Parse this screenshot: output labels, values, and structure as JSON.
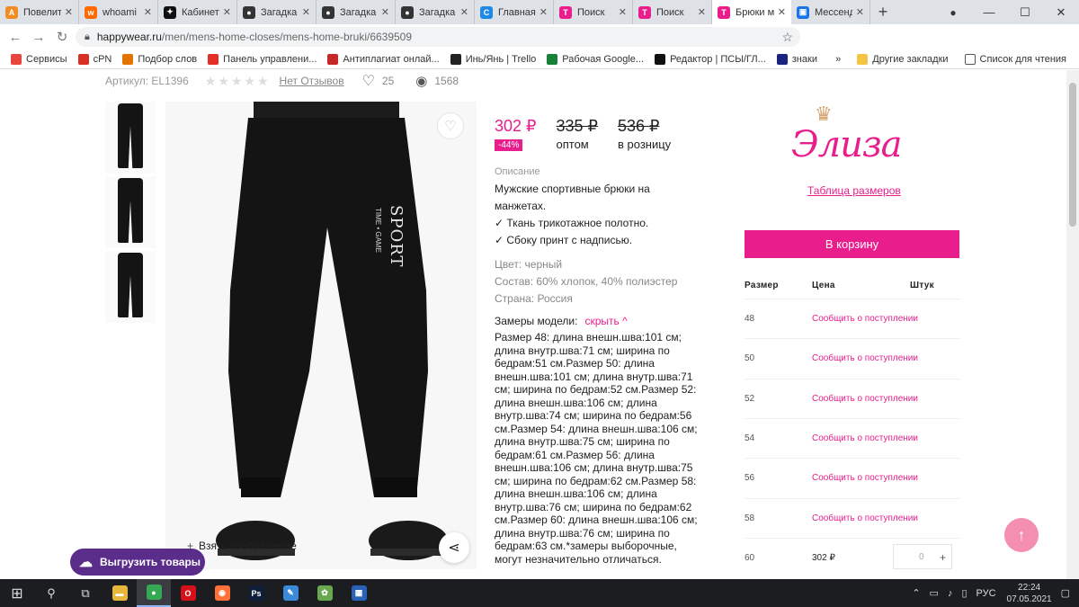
{
  "browser": {
    "tabs": [
      {
        "title": "Повелите",
        "color": "#f28b22",
        "glyph": "A"
      },
      {
        "title": "whoami",
        "color": "#ff6a00",
        "glyph": "w"
      },
      {
        "title": "Кабинет",
        "color": "#111111",
        "glyph": "✦"
      },
      {
        "title": "Загадка с",
        "color": "#333333",
        "glyph": "●"
      },
      {
        "title": "Загадка п",
        "color": "#333333",
        "glyph": "●"
      },
      {
        "title": "Загадка п",
        "color": "#333333",
        "glyph": "●"
      },
      {
        "title": "Главная",
        "color": "#1e88e5",
        "glyph": "C"
      },
      {
        "title": "Поиск",
        "color": "#e91e8c",
        "glyph": "T"
      },
      {
        "title": "Поиск",
        "color": "#e91e8c",
        "glyph": "T"
      },
      {
        "title": "Брюки м",
        "color": "#e91e8c",
        "glyph": "T"
      },
      {
        "title": "Мессенд",
        "color": "#1a73e8",
        "glyph": "▣"
      }
    ],
    "active_tab_index": 9,
    "url_host": "happywear.ru",
    "url_path": "/men/mens-home-closes/mens-home-bruki/6639509",
    "bookmarks": [
      {
        "label": "Сервисы",
        "color": "#e8453c"
      },
      {
        "label": "cPN",
        "color": "#d93025"
      },
      {
        "label": "Подбор слов",
        "color": "#e37400"
      },
      {
        "label": "Панель управлени...",
        "color": "#e52d27"
      },
      {
        "label": "Антиплагиат онлай...",
        "color": "#c62828"
      },
      {
        "label": "Инь/Янь | Trello",
        "color": "#222222"
      },
      {
        "label": "Рабочая Google...",
        "color": "#188038"
      },
      {
        "label": "Редактор | ПСЫ/ГЛ...",
        "color": "#111111"
      },
      {
        "label": "знаки",
        "color": "#1a237e"
      }
    ],
    "bookmarks_right": [
      "Другие закладки",
      "Список для чтения"
    ]
  },
  "product": {
    "article": "Артикул: EL1396",
    "reviews_link": "Нет Отзывов",
    "likes": "25",
    "views": "1568",
    "price_now": "302 ₽",
    "discount_badge": "-44%",
    "price_wholesale": "335 ₽",
    "price_wholesale_label": "оптом",
    "price_retail": "536 ₽",
    "price_retail_label": "в розницу",
    "description_label": "Описание",
    "description_lines": [
      "Мужские спортивные брюки на манжетах.",
      "✓ Ткань трикотажное полотно.",
      "✓ Сбоку принт с надписью."
    ],
    "color_line": "Цвет: черный",
    "composition_line": "Состав: 60% хлопок, 40% полиэстер",
    "country_line": "Страна: Россия",
    "sizes_label": "Замеры модели:",
    "sizes_toggle": "скрыть ^",
    "sizes_text": "Размер 48: длина внешн.шва:101 см; длина внутр.шва:71 см; ширина по бедрам:51 см.Размер 50: длина внешн.шва:101 см; длина внутр.шва:71 см; ширина по бедрам:52 см.Размер 52: длина внешн.шва:106 см; длина внутр.шва:74 см; ширина по бедрам:56 см.Размер 54: длина внешн.шва:106 см; длина внутр.шва:75 см; ширина по бедрам:61 см.Размер 56: длина внешн.шва:106 см; длина внутр.шва:75 см; ширина по бедрам:62 см.Размер 58: длина внешн.шва:106 см; длина внутр.шва:76 см; ширина по бедрам:62 см.Размер 60: длина внешн.шва:106 см; длина внутр.шва:76 см; ширина по бедрам:63 см.*замеры выборочные, могут незначительно отличаться.",
    "take_image": "Взять изображение",
    "upload_button": "Выгрузить товары",
    "print_text": "SPORT",
    "print_sub": "TIME • GAME"
  },
  "sidebar": {
    "logo_text": "Элиза",
    "size_table_link": "Таблица размеров",
    "cart_button": "В корзину",
    "table_headers": {
      "size": "Размер",
      "price": "Цена",
      "qty": "Штук"
    },
    "rows": [
      {
        "size": "48",
        "note": "Сообщить о поступлении"
      },
      {
        "size": "50",
        "note": "Сообщить о поступлении"
      },
      {
        "size": "52",
        "note": "Сообщить о поступлении"
      },
      {
        "size": "54",
        "note": "Сообщить о поступлении"
      },
      {
        "size": "56",
        "note": "Сообщить о поступлении"
      },
      {
        "size": "58",
        "note": "Сообщить о поступлении"
      }
    ],
    "last_row": {
      "size": "60",
      "price": "302 ₽",
      "qty": "0",
      "plus": "+"
    }
  },
  "taskbar": {
    "apps": [
      {
        "name": "search-icon",
        "glyph": "⚲",
        "color": ""
      },
      {
        "name": "task-view-icon",
        "glyph": "⧉",
        "color": ""
      },
      {
        "name": "file-explorer-icon",
        "glyph": "▬",
        "color": "#e8b63a"
      },
      {
        "name": "chrome-icon",
        "glyph": "●",
        "color": "#34a853"
      },
      {
        "name": "opera-icon",
        "glyph": "O",
        "color": "#d5101a"
      },
      {
        "name": "firefox-icon",
        "glyph": "◉",
        "color": "#ff7139"
      },
      {
        "name": "photoshop-icon",
        "glyph": "Ps",
        "color": "#0d1d3a"
      },
      {
        "name": "paint-icon",
        "glyph": "✎",
        "color": "#3b8ad9"
      },
      {
        "name": "app-icon",
        "glyph": "✿",
        "color": "#6aa84f"
      },
      {
        "name": "calculator-icon",
        "glyph": "▦",
        "color": "#2a62b8"
      }
    ],
    "language": "РУС",
    "time": "22:24",
    "date": "07.05.2021"
  },
  "colors": {
    "accent": "#e91e8c",
    "upload": "#5b2d8a"
  }
}
